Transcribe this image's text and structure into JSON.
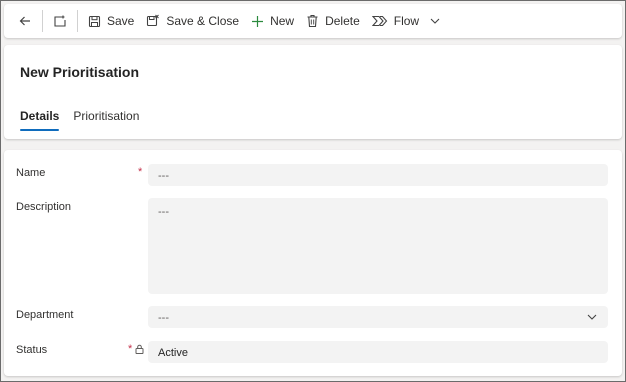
{
  "toolbar": {
    "back_label": "",
    "open_label": "",
    "save_label": "Save",
    "save_close_label": "Save & Close",
    "new_label": "New",
    "delete_label": "Delete",
    "flow_label": "Flow"
  },
  "header": {
    "title": "New Prioritisation",
    "tabs": [
      {
        "label": "Details",
        "active": true
      },
      {
        "label": "Prioritisation",
        "active": false
      }
    ]
  },
  "form": {
    "fields": [
      {
        "label": "Name",
        "value": "---",
        "required": true
      },
      {
        "label": "Description",
        "value": "---",
        "required": false
      },
      {
        "label": "Department",
        "value": "---",
        "required": false
      },
      {
        "label": "Status",
        "value": "Active",
        "required": true,
        "locked": true
      }
    ]
  },
  "colors": {
    "accent": "#0f6cbd",
    "required": "#c4314b",
    "field_bg": "#f3f3f3"
  }
}
